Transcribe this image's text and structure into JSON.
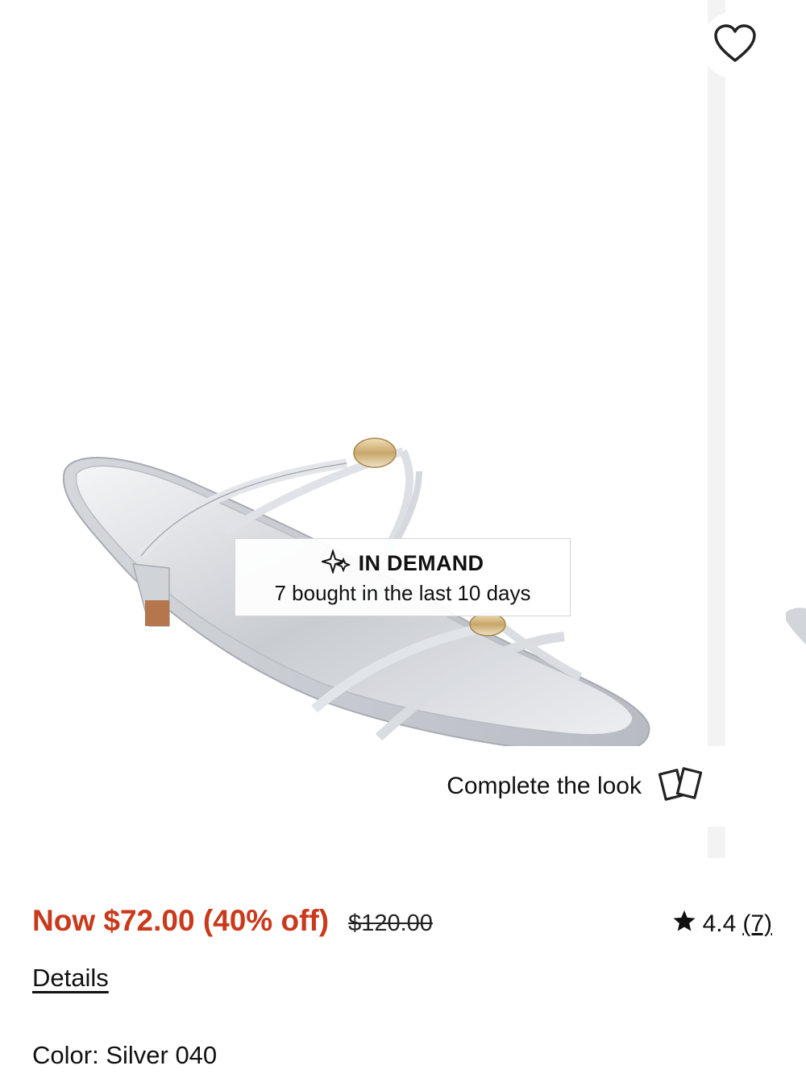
{
  "product": {
    "image_alt": "Silver metallic strappy kitten heel sandal",
    "wishlist_icon": "heart-outline-icon"
  },
  "badge": {
    "icon": "sparkle-icon",
    "title": "IN DEMAND",
    "subtitle": "7 bought in the last 10 days"
  },
  "complete_look": {
    "label": "Complete the look",
    "icon": "cards-icon"
  },
  "pricing": {
    "now": "Now $72.00 (40% off)",
    "was": "$120.00",
    "accent_color": "#c9391b"
  },
  "rating": {
    "icon": "star-icon",
    "value": "4.4",
    "count": "(7)"
  },
  "details": {
    "label": "Details"
  },
  "color": {
    "label": "Color: ",
    "value": "Silver 040"
  }
}
